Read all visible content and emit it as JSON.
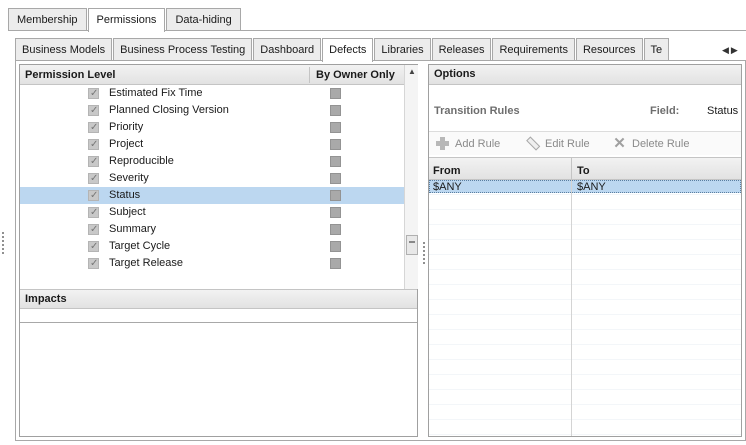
{
  "top_tabs": [
    {
      "label": "Membership",
      "active": false
    },
    {
      "label": "Permissions",
      "active": true
    },
    {
      "label": "Data-hiding",
      "active": false
    }
  ],
  "sub_tabs": [
    {
      "label": "Business Models",
      "active": false
    },
    {
      "label": "Business Process Testing",
      "active": false
    },
    {
      "label": "Dashboard",
      "active": false
    },
    {
      "label": "Defects",
      "active": true
    },
    {
      "label": "Libraries",
      "active": false
    },
    {
      "label": "Releases",
      "active": false
    },
    {
      "label": "Requirements",
      "active": false
    },
    {
      "label": "Resources",
      "active": false
    },
    {
      "label": "Te",
      "active": false
    }
  ],
  "permissions": {
    "column_permission_level": "Permission Level",
    "column_by_owner_only": "By Owner Only",
    "rows": [
      {
        "label": "Estimated Fix Time",
        "checked": true,
        "selected": false
      },
      {
        "label": "Planned Closing Version",
        "checked": true,
        "selected": false
      },
      {
        "label": "Priority",
        "checked": true,
        "selected": false
      },
      {
        "label": "Project",
        "checked": true,
        "selected": false
      },
      {
        "label": "Reproducible",
        "checked": true,
        "selected": false
      },
      {
        "label": "Severity",
        "checked": true,
        "selected": false
      },
      {
        "label": "Status",
        "checked": true,
        "selected": true
      },
      {
        "label": "Subject",
        "checked": true,
        "selected": false
      },
      {
        "label": "Summary",
        "checked": true,
        "selected": false
      },
      {
        "label": "Target Cycle",
        "checked": true,
        "selected": false
      },
      {
        "label": "Target Release",
        "checked": true,
        "selected": false
      }
    ]
  },
  "impacts": {
    "title": "Impacts"
  },
  "options": {
    "title": "Options",
    "transition_rules_label": "Transition Rules",
    "field_label": "Field:",
    "field_value": "Status",
    "toolbar": {
      "add_rule": "Add Rule",
      "edit_rule": "Edit Rule",
      "delete_rule": "Delete Rule"
    },
    "grid": {
      "col_from": "From",
      "col_to": "To",
      "rows": [
        {
          "from": "$ANY",
          "to": "$ANY"
        }
      ]
    }
  },
  "colors": {
    "selection": "#bcd7f0",
    "tab_inactive": "#ececec",
    "header_gray": "#e2e2e2"
  }
}
